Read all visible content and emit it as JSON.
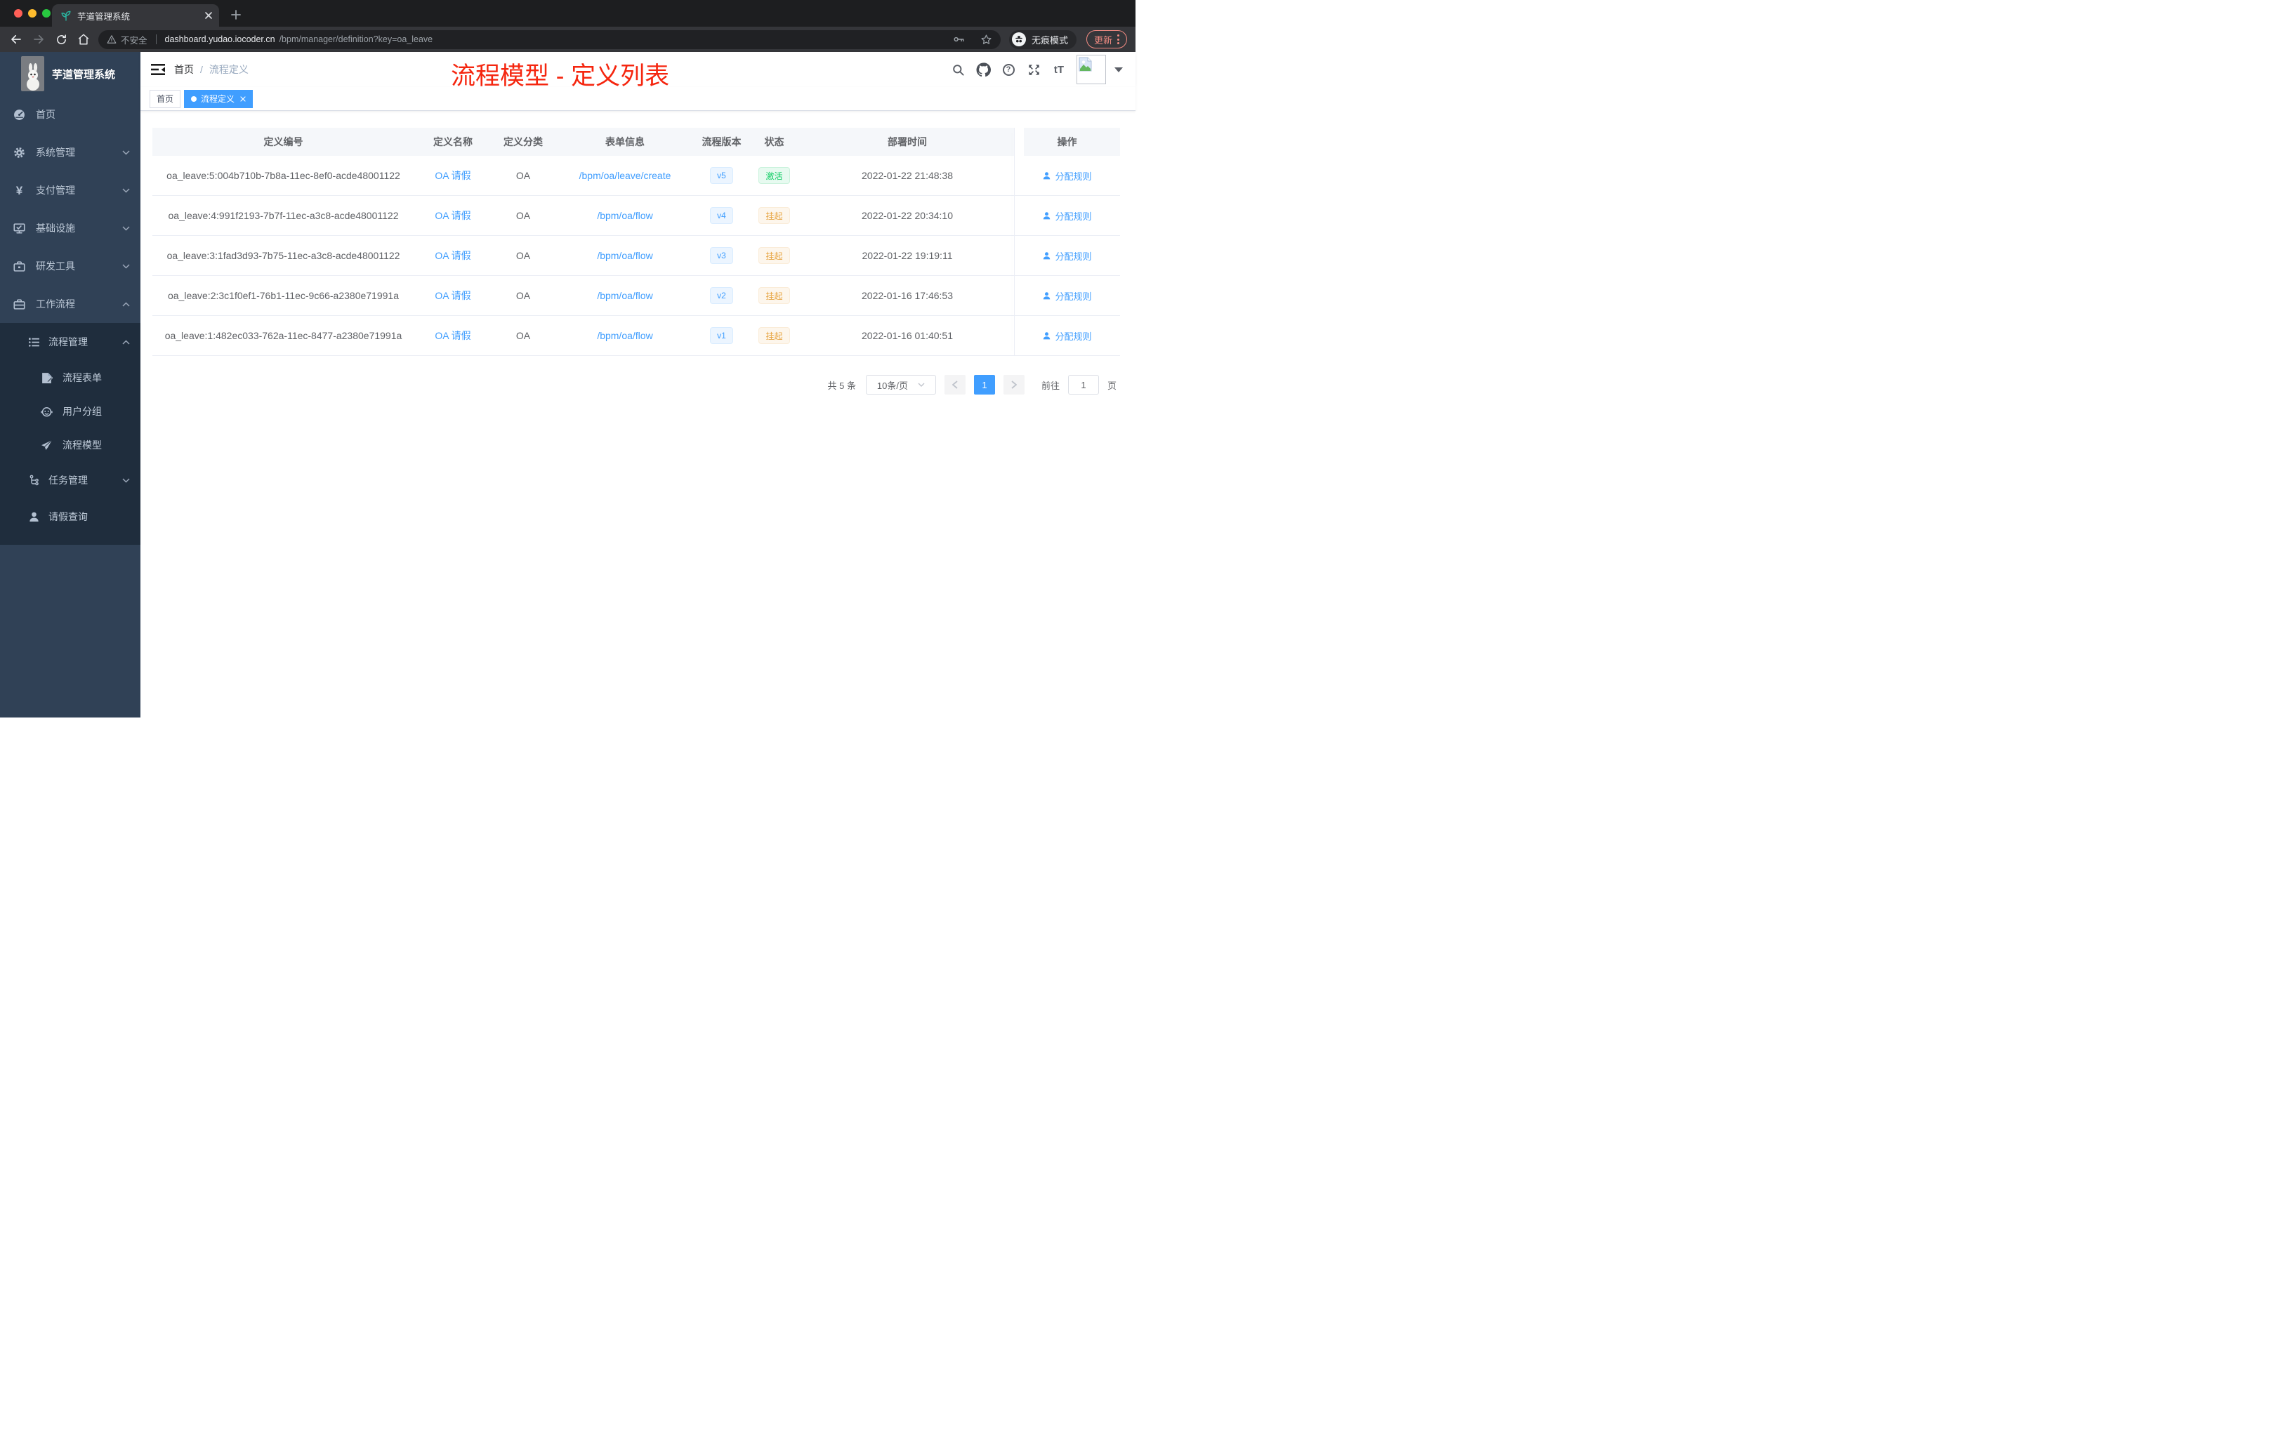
{
  "browser": {
    "tab": {
      "title": "芋道管理系统"
    },
    "toolbar": {
      "not_secure": "不安全",
      "url_host": "dashboard.yudao.iocoder.cn",
      "url_path": "/bpm/manager/definition?key=oa_leave",
      "incognito_label": "无痕模式",
      "update_label": "更新"
    }
  },
  "sidebar": {
    "logo_title": "芋道管理系统",
    "items": [
      {
        "label": "首页",
        "icon": "dashboard-icon",
        "expandable": false
      },
      {
        "label": "系统管理",
        "icon": "gear-icon",
        "state": "collapsed"
      },
      {
        "label": "支付管理",
        "icon": "yen-icon",
        "state": "collapsed",
        "glyph": "¥"
      },
      {
        "label": "基础设施",
        "icon": "monitor-icon",
        "state": "collapsed"
      },
      {
        "label": "研发工具",
        "icon": "toolbox-icon",
        "state": "collapsed"
      },
      {
        "label": "工作流程",
        "icon": "briefcase-icon",
        "state": "expanded"
      }
    ],
    "submenu": {
      "group": {
        "label": "流程管理",
        "state": "expanded"
      },
      "children": [
        {
          "label": "流程表单"
        },
        {
          "label": "用户分组"
        },
        {
          "label": "流程模型"
        }
      ],
      "siblings": [
        {
          "label": "任务管理",
          "state": "collapsed"
        },
        {
          "label": "请假查询"
        }
      ]
    }
  },
  "header": {
    "breadcrumb": [
      "首页",
      "流程定义"
    ],
    "separator": "/",
    "annotation": "流程模型 - 定义列表",
    "help_glyph": "?",
    "fontsize_glyph": "tT"
  },
  "tags": [
    {
      "label": "首页",
      "active": false
    },
    {
      "label": "流程定义",
      "active": true
    }
  ],
  "table": {
    "columns": [
      "定义编号",
      "定义名称",
      "定义分类",
      "表单信息",
      "流程版本",
      "状态",
      "部署时间",
      "操作"
    ],
    "rows": [
      {
        "id": "oa_leave:5:004b710b-7b8a-11ec-8ef0-acde48001122",
        "name": "OA 请假",
        "category": "OA",
        "form": "/bpm/oa/leave/create",
        "version": "v5",
        "status": "激活",
        "status_type": "active",
        "time": "2022-01-22 21:48:38",
        "action": "分配规则"
      },
      {
        "id": "oa_leave:4:991f2193-7b7f-11ec-a3c8-acde48001122",
        "name": "OA 请假",
        "category": "OA",
        "form": "/bpm/oa/flow",
        "version": "v4",
        "status": "挂起",
        "status_type": "suspended",
        "time": "2022-01-22 20:34:10",
        "action": "分配规则"
      },
      {
        "id": "oa_leave:3:1fad3d93-7b75-11ec-a3c8-acde48001122",
        "name": "OA 请假",
        "category": "OA",
        "form": "/bpm/oa/flow",
        "version": "v3",
        "status": "挂起",
        "status_type": "suspended",
        "time": "2022-01-22 19:19:11",
        "action": "分配规则"
      },
      {
        "id": "oa_leave:2:3c1f0ef1-76b1-11ec-9c66-a2380e71991a",
        "name": "OA 请假",
        "category": "OA",
        "form": "/bpm/oa/flow",
        "version": "v2",
        "status": "挂起",
        "status_type": "suspended",
        "time": "2022-01-16 17:46:53",
        "action": "分配规则"
      },
      {
        "id": "oa_leave:1:482ec033-762a-11ec-8477-a2380e71991a",
        "name": "OA 请假",
        "category": "OA",
        "form": "/bpm/oa/flow",
        "version": "v1",
        "status": "挂起",
        "status_type": "suspended",
        "time": "2022-01-16 01:40:51",
        "action": "分配规则"
      }
    ]
  },
  "pagination": {
    "total_label": "共 5 条",
    "page_size": "10条/页",
    "current_page": "1",
    "goto_label": "前往",
    "goto_value": "1",
    "unit_label": "页"
  },
  "colors": {
    "accent": "#409eff",
    "annotation_red": "#f5260f",
    "status_active": "#13ce66",
    "status_suspended": "#e6a23c",
    "sidebar_bg": "#304156",
    "submenu_bg": "#1f2d3d"
  }
}
